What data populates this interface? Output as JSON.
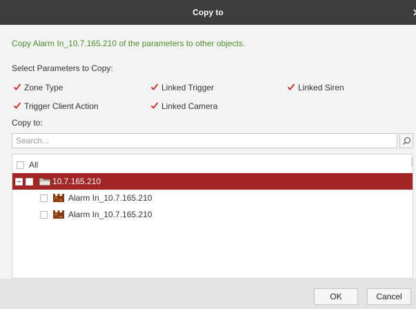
{
  "window": {
    "title": "Copy to",
    "close_label": "x"
  },
  "description": "Copy Alarm In_10.7.165.210 of the parameters to other objects.",
  "parameters": {
    "heading": "Select Parameters to Copy:",
    "options": [
      {
        "label": "Zone Type",
        "checked": true
      },
      {
        "label": "Linked Trigger",
        "checked": true
      },
      {
        "label": "Linked Siren",
        "checked": true
      },
      {
        "label": "Trigger Client Action",
        "checked": true
      },
      {
        "label": "Linked Camera",
        "checked": true
      }
    ],
    "check_color": "#c8342b"
  },
  "copy_to": {
    "heading": "Copy to:",
    "search_placeholder": "Search..."
  },
  "tree": {
    "all_label": "All",
    "device": {
      "label": "10.7.165.210",
      "checked": false,
      "expanded": true
    },
    "children": [
      {
        "label": "Alarm In_10.7.165.210",
        "checked": false
      },
      {
        "label": "Alarm In_10.7.165.210",
        "checked": false
      }
    ],
    "selected_color": "#a32525"
  },
  "footer": {
    "ok_label": "OK",
    "cancel_label": "Cancel"
  }
}
